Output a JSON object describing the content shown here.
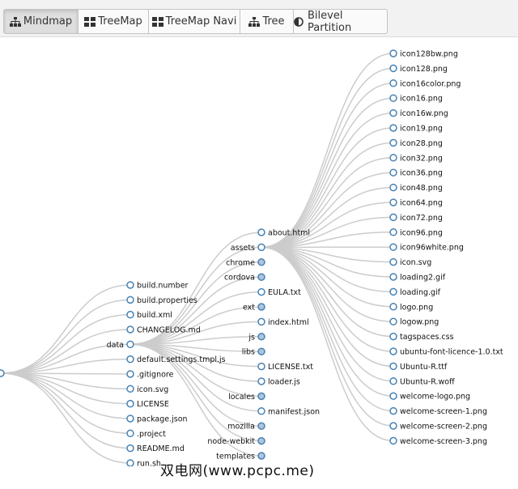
{
  "toolbar": {
    "buttons": [
      {
        "label": "Mindmap",
        "icon": "sitemap-icon",
        "active": true
      },
      {
        "label": "TreeMap",
        "icon": "grid-icon",
        "active": false
      },
      {
        "label": "TreeMap Navi",
        "icon": "grid-icon",
        "active": false
      },
      {
        "label": "Tree",
        "icon": "sitemap-icon",
        "active": false
      },
      {
        "label": "Bilevel Partition",
        "icon": "half-circle-icon",
        "active": false
      }
    ]
  },
  "tree": {
    "colors": {
      "link": "#cccccc",
      "node_stroke": "#4682b4",
      "node_collapsed_fill": "#b0c4de",
      "node_fill": "#ffffff"
    },
    "root_children": [
      {
        "label": "build.number",
        "collapsed": false
      },
      {
        "label": "build.properties",
        "collapsed": false
      },
      {
        "label": "build.xml",
        "collapsed": false
      },
      {
        "label": "CHANGELOG.md",
        "collapsed": false
      },
      {
        "label": "data",
        "collapsed": false
      },
      {
        "label": "default.settings.tmpl.js",
        "collapsed": false
      },
      {
        "label": ".gitignore",
        "collapsed": false
      },
      {
        "label": "icon.svg",
        "collapsed": false
      },
      {
        "label": "LICENSE",
        "collapsed": false
      },
      {
        "label": "package.json",
        "collapsed": false
      },
      {
        "label": ".project",
        "collapsed": false
      },
      {
        "label": "README.md",
        "collapsed": false
      },
      {
        "label": "run.sh",
        "collapsed": false
      }
    ],
    "data_children": [
      {
        "label": "about.html",
        "collapsed": false,
        "side": "right"
      },
      {
        "label": "assets",
        "collapsed": false,
        "side": "left"
      },
      {
        "label": "chrome",
        "collapsed": true,
        "side": "left"
      },
      {
        "label": "cordova",
        "collapsed": true,
        "side": "left"
      },
      {
        "label": "EULA.txt",
        "collapsed": false,
        "side": "right"
      },
      {
        "label": "ext",
        "collapsed": true,
        "side": "left"
      },
      {
        "label": "index.html",
        "collapsed": false,
        "side": "right"
      },
      {
        "label": "js",
        "collapsed": true,
        "side": "left"
      },
      {
        "label": "libs",
        "collapsed": true,
        "side": "left"
      },
      {
        "label": "LICENSE.txt",
        "collapsed": false,
        "side": "right"
      },
      {
        "label": "loader.js",
        "collapsed": false,
        "side": "right"
      },
      {
        "label": "locales",
        "collapsed": true,
        "side": "left"
      },
      {
        "label": "manifest.json",
        "collapsed": false,
        "side": "right"
      },
      {
        "label": "mozilla",
        "collapsed": true,
        "side": "left"
      },
      {
        "label": "node-webkit",
        "collapsed": true,
        "side": "left"
      },
      {
        "label": "templates",
        "collapsed": true,
        "side": "left"
      }
    ],
    "assets_children": [
      "icon128bw.png",
      "icon128.png",
      "icon16color.png",
      "icon16.png",
      "icon16w.png",
      "icon19.png",
      "icon28.png",
      "icon32.png",
      "icon36.png",
      "icon48.png",
      "icon64.png",
      "icon72.png",
      "icon96.png",
      "icon96white.png",
      "icon.svg",
      "loading2.gif",
      "loading.gif",
      "logo.png",
      "logow.png",
      "tagspaces.css",
      "ubuntu-font-licence-1.0.txt",
      "Ubuntu-R.ttf",
      "Ubuntu-R.woff",
      "welcome-logo.png",
      "welcome-screen-1.png",
      "welcome-screen-2.png",
      "welcome-screen-3.png"
    ]
  },
  "watermark": "双电网(www.pcpc.me)"
}
